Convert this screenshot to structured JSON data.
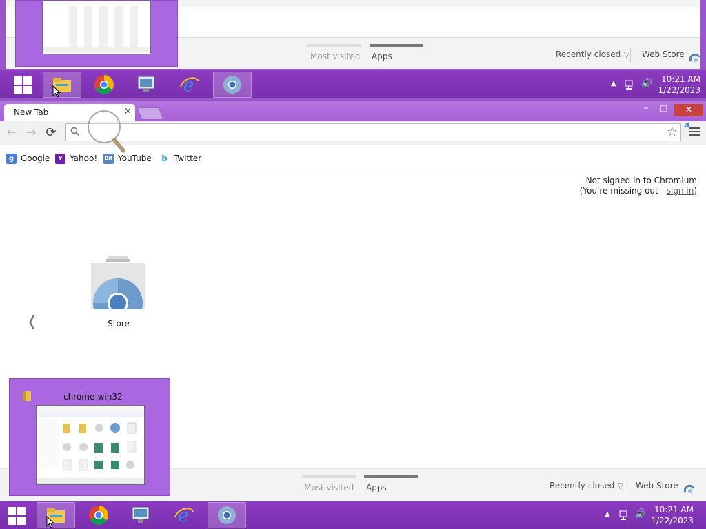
{
  "top_clone": {
    "ntp_tabs": [
      {
        "label": "Most visited"
      },
      {
        "label": "Apps"
      }
    ],
    "recently_closed": "Recently closed",
    "web_store": "Web Store",
    "clock_time": "10:21 AM",
    "clock_date": "1/22/2023"
  },
  "browser": {
    "tab_title": "New Tab",
    "tab_close": "×",
    "window_controls": {
      "minimize": "–",
      "restore": "❐",
      "close": "✕"
    },
    "omnibox": {
      "value": "",
      "placeholder": ""
    },
    "extension_badge": "a",
    "bookmarks": [
      {
        "label": "Google",
        "icon": "google-icon"
      },
      {
        "label": "Yahoo!",
        "icon": "yahoo-icon"
      },
      {
        "label": "YouTube",
        "icon": "youtube-icon"
      },
      {
        "label": "Twitter",
        "icon": "twitter-icon"
      }
    ]
  },
  "content": {
    "signin_line1": "Not signed in to Chromium",
    "signin_line2_prefix": "(You're missing out—",
    "signin_link": "sign in",
    "signin_suffix": ")",
    "apps": [
      {
        "label": "Store",
        "icon": "chrome-web-store-icon"
      }
    ],
    "prev_page_glyph": "❬"
  },
  "ntp_footer": {
    "tabs": [
      {
        "label": "Most visited"
      },
      {
        "label": "Apps"
      }
    ],
    "recently_closed": "Recently closed",
    "web_store": "Web Store"
  },
  "thumbnail_popup": {
    "title": "chrome-win32"
  },
  "taskbar": {
    "apps": [
      {
        "name": "file-explorer",
        "icon": "folder-icon",
        "active": true
      },
      {
        "name": "google-chrome",
        "icon": "chrome-icon",
        "active": false
      },
      {
        "name": "remote-desktop",
        "icon": "remote-desktop-icon",
        "active": false
      },
      {
        "name": "internet-explorer",
        "icon": "ie-icon",
        "active": false
      },
      {
        "name": "chromium",
        "icon": "chromium-icon",
        "active": true
      }
    ],
    "clock_time": "10:21 AM",
    "clock_date": "1/22/2023"
  },
  "colors": {
    "accent_purple": "#9a55cc",
    "taskbar": "#7a2fae",
    "close_red": "#c94040"
  }
}
